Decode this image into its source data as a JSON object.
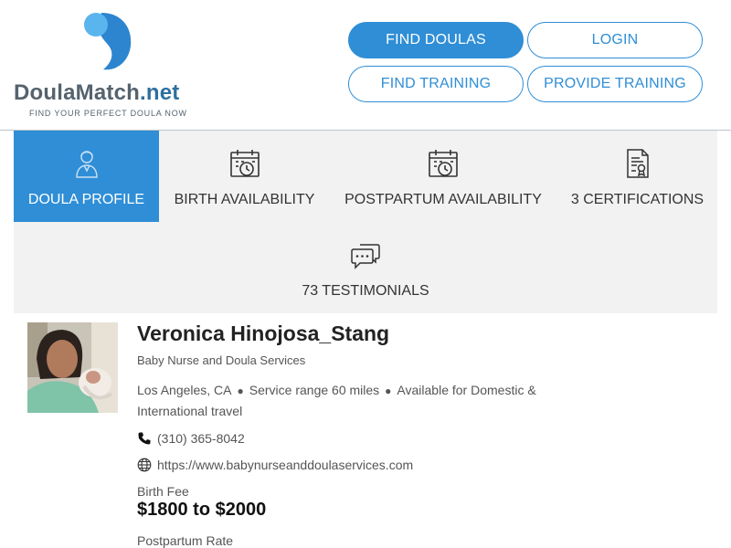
{
  "logo": {
    "name_main": "DoulaMatch",
    "name_tld": ".net",
    "tagline": "FIND YOUR PERFECT DOULA NOW"
  },
  "nav": {
    "find_doulas": "FIND DOULAS",
    "login": "LOGIN",
    "find_training": "FIND TRAINING",
    "provide_training": "PROVIDE TRAINING"
  },
  "tabs": [
    {
      "label": "DOULA PROFILE",
      "icon": "doula-person-icon",
      "active": true
    },
    {
      "label": "BIRTH AVAILABILITY",
      "icon": "calendar-clock-icon",
      "active": false
    },
    {
      "label": "POSTPARTUM AVAILABILITY",
      "icon": "calendar-clock-icon",
      "active": false
    },
    {
      "label": "3 CERTIFICATIONS",
      "icon": "certificate-icon",
      "active": false
    },
    {
      "label": "73 TESTIMONIALS",
      "icon": "chat-bubbles-icon",
      "active": false
    }
  ],
  "profile": {
    "name": "Veronica Hinojosa_Stang",
    "business": "Baby Nurse and Doula Services",
    "location": "Los Angeles, CA",
    "service_range": "Service range 60 miles",
    "availability": "Available for Domestic & International travel",
    "phone": "(310) 365-8042",
    "website": "https://www.babynurseanddoulaservices.com",
    "birth_fee_label": "Birth Fee",
    "birth_fee": "$1800 to $2000",
    "postpartum_label": "Postpartum Rate"
  },
  "colors": {
    "accent": "#2f8ed6",
    "tab_background": "#f2f2f2",
    "logo_light_blue": "#5ab4ee",
    "logo_dark_blue": "#2d85cf"
  }
}
